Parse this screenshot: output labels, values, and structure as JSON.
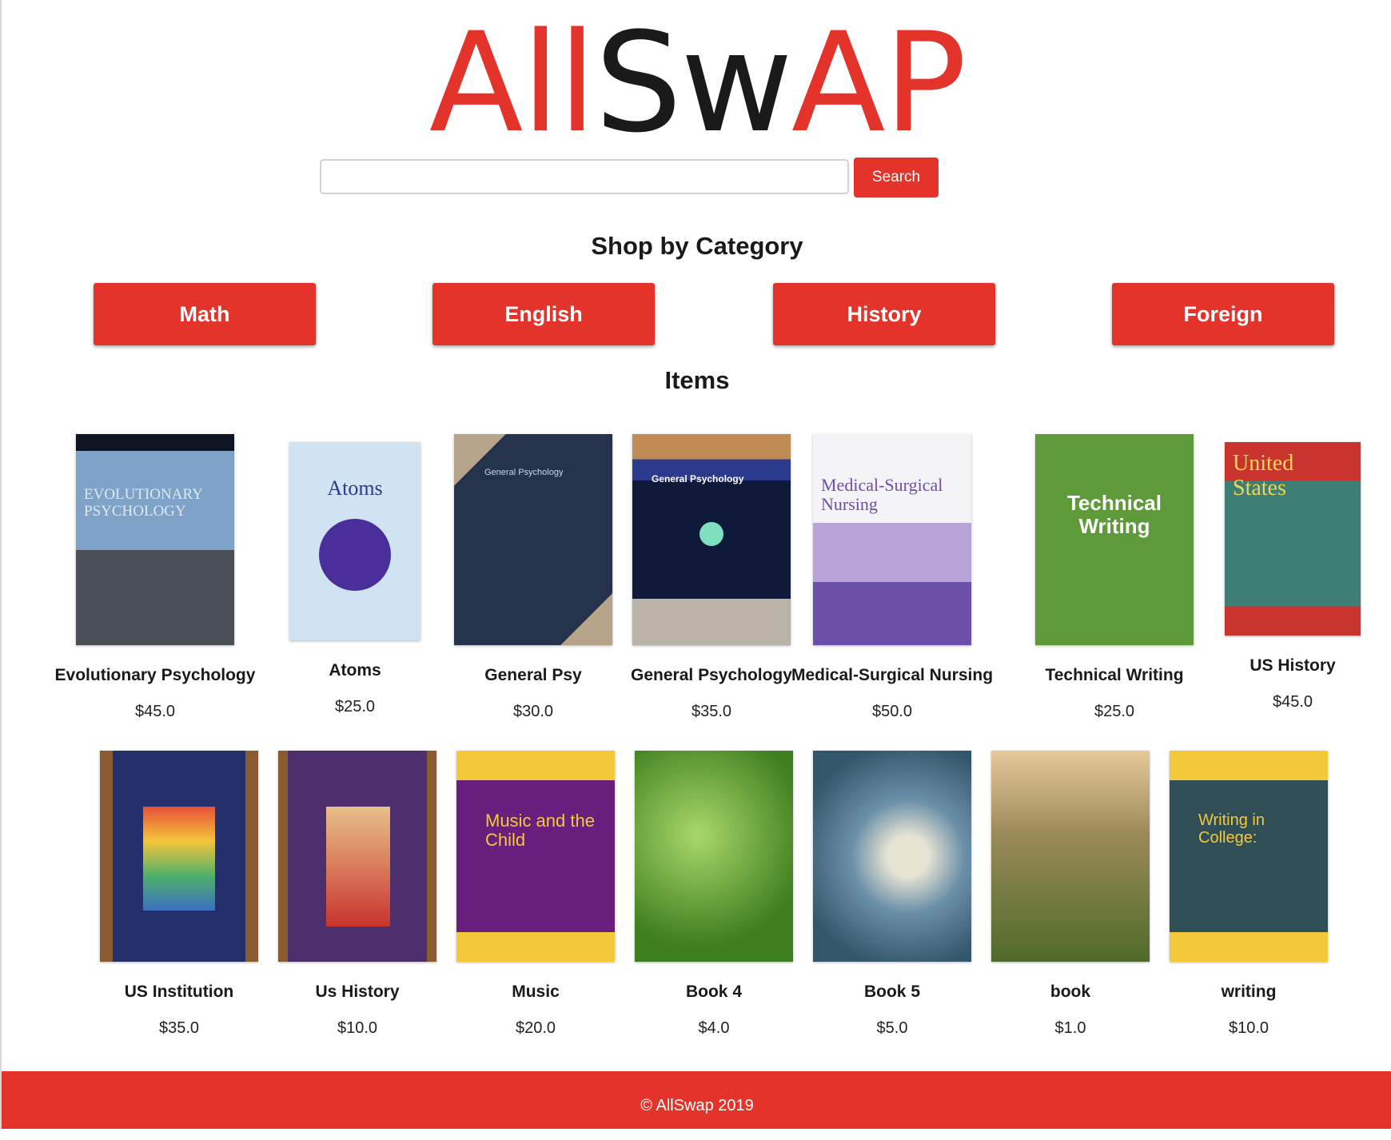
{
  "header": {
    "logo": {
      "part1": "All",
      "part2": "Sw",
      "part3": "AP"
    },
    "search": {
      "placeholder": "",
      "button_label": "Search"
    }
  },
  "categories": {
    "heading": "Shop by Category",
    "items": [
      "Math",
      "English",
      "History",
      "Foreign"
    ]
  },
  "items": {
    "heading": "Items",
    "row1": [
      {
        "title": "Evolutionary Psychology",
        "price": "$45.0",
        "cover": {
          "bg": "#6e8fb4",
          "text": "EVOLUTIONARY PSYCHOLOGY"
        }
      },
      {
        "title": "Atoms",
        "price": "$25.0",
        "cover": {
          "bg": "#cfe3f3",
          "text": "Atoms"
        }
      },
      {
        "title": "General Psy",
        "price": "$30.0",
        "cover": {
          "bg": "#25324c",
          "text": "General Psychology"
        }
      },
      {
        "title": "General Psychology",
        "price": "$35.0",
        "cover": {
          "bg": "#2b3a8c",
          "text": "General Psychology"
        }
      },
      {
        "title": "Medical-Surgical Nursing",
        "price": "$50.0",
        "cover": {
          "bg": "#f2f1f5",
          "text": "Medical-Surgical Nursing"
        }
      },
      {
        "title": "Technical Writing",
        "price": "$25.0",
        "cover": {
          "bg": "#5e9a3a",
          "text": "Technical Writing"
        }
      },
      {
        "title": "US History",
        "price": "$45.0",
        "cover": {
          "bg": "#3d7f74",
          "text": "United States"
        }
      }
    ],
    "row2": [
      {
        "title": "US Institution",
        "price": "$35.0",
        "cover": {
          "bg": "#23306b",
          "text": ""
        }
      },
      {
        "title": "Us History",
        "price": "$10.0",
        "cover": {
          "bg": "#4d2f6e",
          "text": ""
        }
      },
      {
        "title": "Music",
        "price": "$20.0",
        "cover": {
          "bg": "#6a1f7f",
          "text": "Music and the Child"
        }
      },
      {
        "title": "Book 4",
        "price": "$4.0",
        "cover": {
          "bg": "#5e9a2c",
          "text": ""
        }
      },
      {
        "title": "Book 5",
        "price": "$5.0",
        "cover": {
          "bg": "#3f6f8c",
          "text": ""
        }
      },
      {
        "title": "book",
        "price": "$1.0",
        "cover": {
          "bg": "#7b8448",
          "text": ""
        }
      },
      {
        "title": "writing",
        "price": "$10.0",
        "cover": {
          "bg": "#2f4e56",
          "text": "Writing in College:"
        }
      }
    ]
  },
  "footer": {
    "text": "© AllSwap 2019"
  },
  "colors": {
    "brand": "#e3332a",
    "logo_dark": "#1a1a1a"
  }
}
